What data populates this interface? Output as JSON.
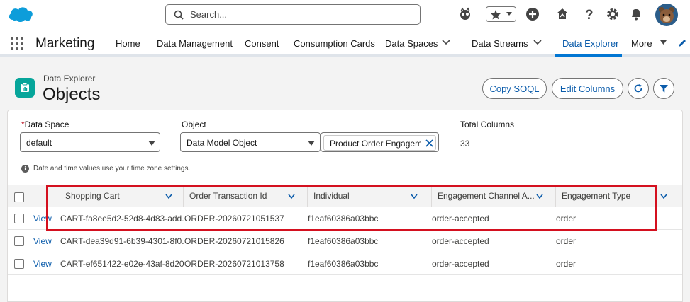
{
  "header": {
    "search_placeholder": "Search..."
  },
  "nav": {
    "app_name": "Marketing",
    "items": [
      {
        "label": "Home"
      },
      {
        "label": "Data Management"
      },
      {
        "label": "Consent"
      },
      {
        "label": "Consumption Cards"
      },
      {
        "label": "Data Spaces"
      },
      {
        "label": "Data Streams"
      },
      {
        "label": "Data Explorer"
      },
      {
        "label": "More"
      }
    ],
    "active": "Data Explorer"
  },
  "page": {
    "breadcrumb": "Data Explorer",
    "title": "Objects",
    "buttons": {
      "copy_soql": "Copy SOQL",
      "edit_columns": "Edit Columns"
    }
  },
  "filters": {
    "data_space_label": "Data Space",
    "data_space_required_mark": "*",
    "data_space_value": "default",
    "object_label": "Object",
    "object_type_value": "Data Model Object",
    "object_value": "Product Order Engagem",
    "total_columns_label": "Total Columns",
    "total_columns_value": "33",
    "timezone_note": "Date and time values use your time zone settings."
  },
  "table": {
    "columns": [
      {
        "label": "Shopping Cart"
      },
      {
        "label": "Order Transaction Id"
      },
      {
        "label": "Individual"
      },
      {
        "label": "Engagement Channel A..."
      },
      {
        "label": "Engagement Type"
      }
    ],
    "view_label": "View",
    "rows": [
      {
        "cart": "CART-fa8ee5d2-52d8-4d83-add...",
        "order": "ORDER-20260721051537",
        "individual": "f1eaf60386a03bbc",
        "channel": "order-accepted",
        "type": "order"
      },
      {
        "cart": "CART-dea39d91-6b39-4301-8f0...",
        "order": "ORDER-20260721015826",
        "individual": "f1eaf60386a03bbc",
        "channel": "order-accepted",
        "type": "order"
      },
      {
        "cart": "CART-ef651422-e02e-43af-8d20...",
        "order": "ORDER-20260721013758",
        "individual": "f1eaf60386a03bbc",
        "channel": "order-accepted",
        "type": "order"
      }
    ]
  },
  "colors": {
    "brand_blue": "#0176d3",
    "link_blue": "#0b5cab",
    "highlight_red": "#d4101f",
    "object_icon_teal": "#06a59a"
  }
}
